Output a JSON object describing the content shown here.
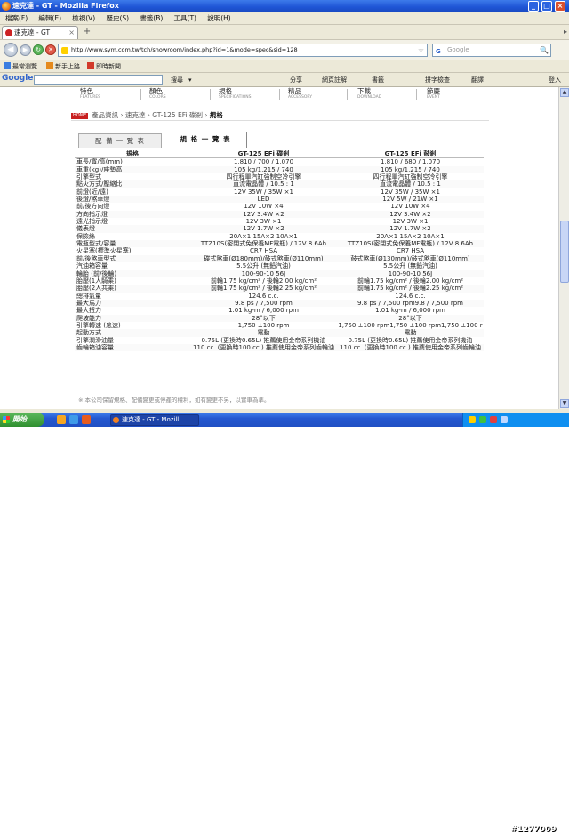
{
  "window": {
    "title": "速克達 - GT - Mozilla Firefox",
    "min": "_",
    "max": "□",
    "close": "×"
  },
  "menu": [
    "檔案(F)",
    "編輯(E)",
    "檢視(V)",
    "歷史(S)",
    "書籤(B)",
    "工具(T)",
    "說明(H)"
  ],
  "tab": {
    "label": "速克達 - GT",
    "close": "×",
    "new": "+",
    "scroll": "▸"
  },
  "nav": {
    "back": "◀",
    "forward": "▶",
    "reload": "↻",
    "stop": "✕",
    "home": "⌂",
    "url": "http://www.sym.com.tw/tch/showroom/index.php?id=1&mode=spec&sid=128",
    "star": "☆",
    "search_placeholder": "Google",
    "search_engine": "G",
    "search_btn": "🔍"
  },
  "bookmarks": [
    {
      "label": "最常瀏覽",
      "color": "#3a7de0"
    },
    {
      "label": "新手上路",
      "color": "#e58a1c"
    },
    {
      "label": "即時新聞",
      "color": "#d23a2a"
    }
  ],
  "google_toolbar": {
    "logo": "Google",
    "items": [
      "搜尋",
      "▾",
      "分享",
      "網頁註解",
      "書籤",
      "拼字檢查",
      "翻譯",
      "登入"
    ]
  },
  "site_nav": [
    {
      "zh": "特色",
      "en": "FEATURES"
    },
    {
      "zh": "顏色",
      "en": "COLORS"
    },
    {
      "zh": "規格",
      "en": "SPECIFICATIONS"
    },
    {
      "zh": "精品",
      "en": "ACCESSORY"
    },
    {
      "zh": "下載",
      "en": "DOWNLOAD"
    },
    {
      "zh": "節慶",
      "en": "EVENT"
    }
  ],
  "breadcrumb": {
    "home": "HOME",
    "path": "產品資訊 › 速克達 › GT-125 EFi 碟剎 › ",
    "current": "規格"
  },
  "tabs": {
    "equipment": "配 備 一 覽 表",
    "spec": "規 格 一 覽 表"
  },
  "spec": {
    "headers": [
      "規格",
      "GT-125 EFi 碟剎",
      "GT-125 EFi 鼓剎"
    ],
    "rows": [
      [
        "車長/寬/高(mm)",
        "1,810 / 700 / 1,070",
        "1,810 / 680 / 1,070"
      ],
      [
        "車重(kg)/座墊高",
        "105 kg/1,215 / 740",
        "105 kg/1,215 / 740"
      ],
      [
        "引擎型式",
        "四行程單汽缸強制空冷引擎",
        "四行程單汽缸強制空冷引擎"
      ],
      [
        "點火方式/壓縮比",
        "直流電晶體 / 10.5 : 1",
        "直流電晶體 / 10.5 : 1"
      ],
      [
        "前燈(近/遠)",
        "12V 35W / 35W ×1",
        "12V 35W / 35W ×1"
      ],
      [
        "後燈/煞車燈",
        "LED",
        "12V 5W / 21W ×1"
      ],
      [
        "前/後方向燈",
        "12V 10W ×4",
        "12V 10W ×4"
      ],
      [
        "方向指示燈",
        "12V 3.4W ×2",
        "12V 3.4W ×2"
      ],
      [
        "遠光指示燈",
        "12V 3W ×1",
        "12V 3W ×1"
      ],
      [
        "儀表燈",
        "12V 1.7W ×2",
        "12V 1.7W ×2"
      ],
      [
        "保險絲",
        "20A×1 15A×2 10A×1",
        "20A×1 15A×2 10A×1"
      ],
      [
        "電瓶型式/容量",
        "TTZ10S(密閉式免保養MF電瓶) / 12V 8.6Ah",
        "TTZ10S(密閉式免保養MF電瓶) / 12V 8.6Ah"
      ],
      [
        "火星塞(標準火星塞)",
        "CR7 HSA",
        "CR7 HSA"
      ],
      [
        "前/後煞車型式",
        "碟式煞車(Ø180mm)/鼓式煞車(Ø110mm)",
        "鼓式煞車(Ø130mm)/鼓式煞車(Ø110mm)"
      ],
      [
        "汽油箱容量",
        "5.5公升 (無鉛汽油)",
        "5.5公升 (無鉛汽油)"
      ],
      [
        "輪胎 (前/後輪)",
        "100-90-10 56J",
        "100-90-10 56J"
      ],
      [
        "胎壓(1人騎乘)",
        "前輪1.75 kg/cm² / 後輪2.00 kg/cm²",
        "前輪1.75 kg/cm² / 後輪2.00 kg/cm²"
      ],
      [
        "胎壓(2人共乘)",
        "前輪1.75 kg/cm² / 後輪2.25 kg/cm²",
        "前輪1.75 kg/cm² / 後輪2.25 kg/cm²"
      ],
      [
        "總排氣量",
        "124.6 c.c.",
        "124.6 c.c."
      ],
      [
        "最大馬力",
        "9.8 ps / 7,500 rpm",
        "9.8 ps / 7,500 rpm9.8 / 7,500 rpm"
      ],
      [
        "最大扭力",
        "1.01 kg-m / 6,000 rpm",
        "1.01 kg-m / 6,000 rpm"
      ],
      [
        "爬坡能力",
        "28°以下",
        "28°以下"
      ],
      [
        "引擎轉速 (怠速)",
        "1,750 ±100 rpm",
        "1,750 ±100 rpm1,750 ±100 rpm1,750 ±100 r"
      ],
      [
        "起動方式",
        "電動",
        "電動"
      ],
      [
        "引擎潤滑油量",
        "0.75L (更換時0.65L) 推薦使用金帝系列機油",
        "0.75L (更換時0.65L) 推薦使用金帝系列機油"
      ],
      [
        "齒輪箱油容量",
        "110 cc. (更換時100 cc.) 推薦使用金帝系列齒輪油",
        "110 cc. (更換時100 cc.) 推薦使用金帝系列齒輪油"
      ]
    ]
  },
  "note": "※ 本公司保留規格、配備變更或停產的權利，如有變更不另，以實車為準。",
  "taskbar": {
    "start": "開始",
    "item": "速克達 - GT - Mozill...",
    "watermark": "#1277009"
  }
}
